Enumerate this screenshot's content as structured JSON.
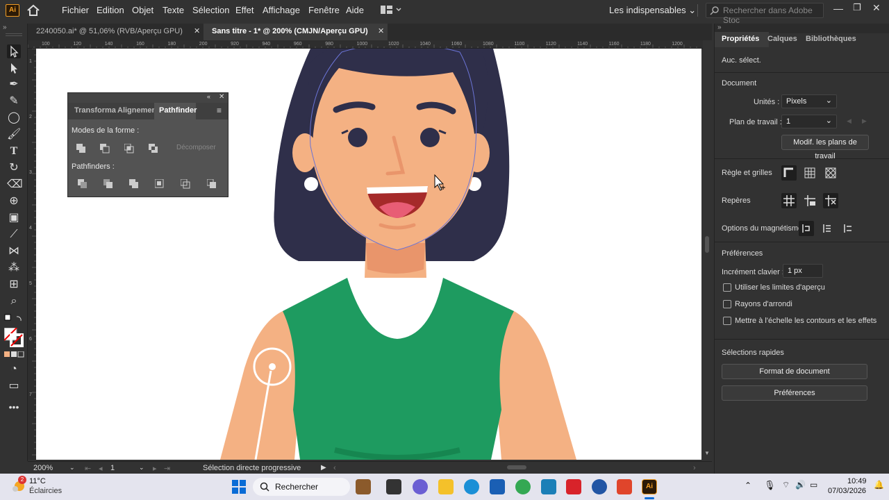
{
  "app": {
    "logo": "Ai"
  },
  "menu": [
    "Fichier",
    "Edition",
    "Objet",
    "Texte",
    "Sélection",
    "Effet",
    "Affichage",
    "Fenêtre",
    "Aide"
  ],
  "workspace": {
    "label": "Les indispensables"
  },
  "search": {
    "placeholder": "Rechercher dans Adobe Stoc"
  },
  "tabs": [
    {
      "label": "2240050.ai* @ 51,06% (RVB/Aperçu GPU)",
      "active": false
    },
    {
      "label": "Sans titre - 1* @ 200% (CMJN/Aperçu GPU)",
      "active": true
    }
  ],
  "ruler_top": [
    "100",
    "120",
    "140",
    "160",
    "180",
    "200",
    "920",
    "940",
    "960",
    "980",
    "1000",
    "1020",
    "1040",
    "1060",
    "1080",
    "1100",
    "1120",
    "1140",
    "1160",
    "1180",
    "1200"
  ],
  "ruler_left": [
    "1",
    "2",
    "3",
    "4",
    "5",
    "6",
    "7"
  ],
  "pathfinder": {
    "tabs": [
      "Transforma",
      "Alignemen",
      "Pathfinder"
    ],
    "active_tab": "Pathfinder",
    "shape_modes_label": "Modes de la forme :",
    "expand_label": "Décomposer",
    "pathfinders_label": "Pathfinders :"
  },
  "status": {
    "zoom": "200%",
    "artboard": "1",
    "tool": "Sélection directe progressive"
  },
  "properties": {
    "tabs": [
      "Propriétés",
      "Calques",
      "Bibliothèques"
    ],
    "no_selection": "Auc. sélect.",
    "document": "Document",
    "units_label": "Unités :",
    "units_value": "Pixels",
    "artboard_label": "Plan de travail :",
    "artboard_value": "1",
    "edit_artboards": "Modif. les plans de travail",
    "rulers_grids": "Règle et grilles",
    "guides": "Repères",
    "snap_options": "Options du magnétisme",
    "preferences_header": "Préférences",
    "keyboard_increment_label": "Incrément clavier :",
    "keyboard_increment_value": "1 px",
    "checkboxes": [
      "Utiliser les limites d'aperçu",
      "Rayons d'arrondi",
      "Mettre à l'échelle les contours et les effets"
    ],
    "quick_actions": "Sélections rapides",
    "doc_setup_btn": "Format de document",
    "prefs_btn": "Préférences"
  },
  "taskbar": {
    "weather_temp": "11°C",
    "weather_desc": "Éclaircies",
    "weather_badge": "2",
    "search_label": "Rechercher",
    "time": "10:49",
    "date": "07/03/2026"
  },
  "colors": {
    "hair": "#2f2f4a",
    "skin": "#f4b183",
    "shirt": "#1e9b60",
    "mouth": "#a52a2a",
    "tongue": "#e85d75",
    "selection": "#6b74d6",
    "accent": "#f29d22"
  }
}
